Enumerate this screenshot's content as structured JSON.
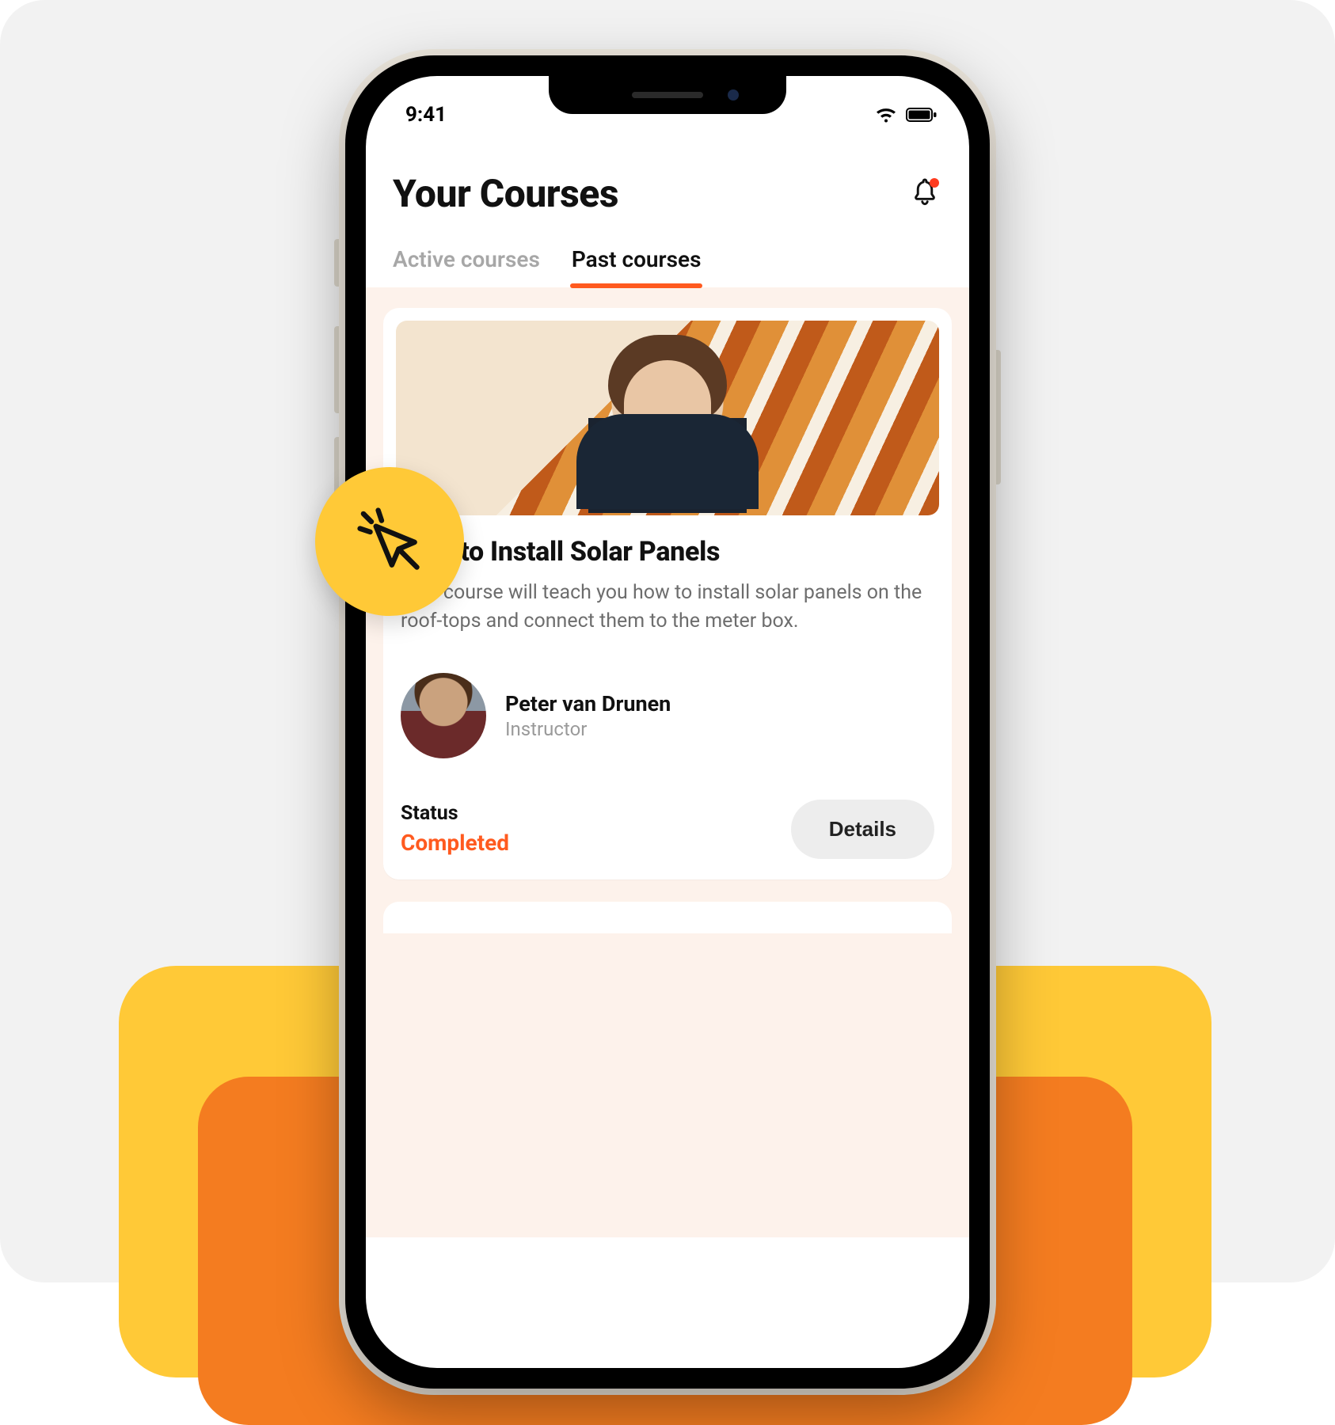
{
  "status_bar": {
    "time": "9:41"
  },
  "header": {
    "title": "Your Courses",
    "notifications_unread": true
  },
  "tabs": {
    "active_index": 1,
    "items": [
      {
        "label": "Active courses"
      },
      {
        "label": "Past courses"
      }
    ]
  },
  "course": {
    "title": "How to Install Solar Panels",
    "description": "This course will teach you how to install solar panels on the roof-tops and connect them to the meter box.",
    "instructor": {
      "name": "Peter van Drunen",
      "role": "Instructor"
    },
    "status_label": "Status",
    "status_value": "Completed",
    "details_label": "Details"
  },
  "colors": {
    "accent": "#ff5a1f",
    "badge_yellow": "#ffc937",
    "deco_orange": "#f47c20"
  }
}
